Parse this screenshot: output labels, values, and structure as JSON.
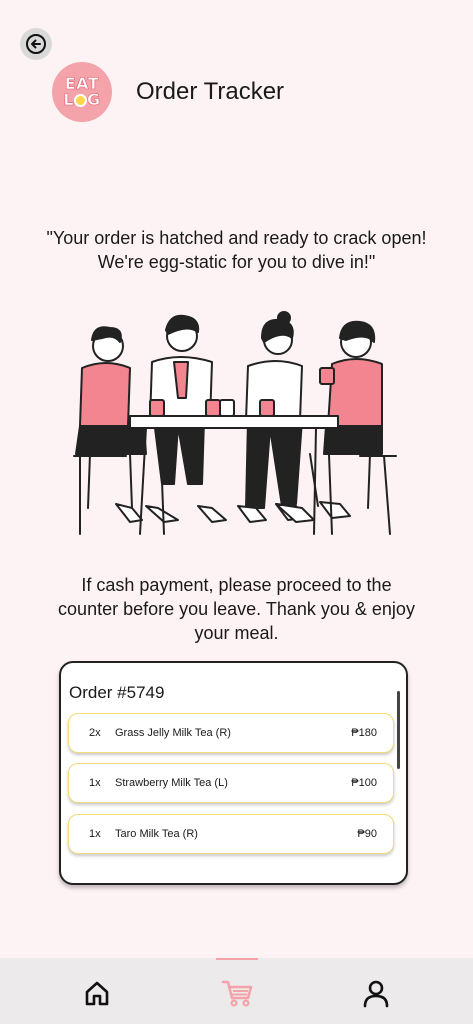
{
  "header": {
    "title": "Order Tracker",
    "logo_line1": "EAT",
    "logo_line2": "L G"
  },
  "messages": {
    "quote": "\"Your order is hatched and ready to crack open! We're egg-static for you to dive in!\"",
    "notice": "If cash payment, please proceed to the counter before you leave. Thank you & enjoy your meal."
  },
  "order": {
    "title": "Order #5749",
    "items": [
      {
        "qty": "2x",
        "name": "Grass Jelly Milk Tea (R)",
        "price": "₱180"
      },
      {
        "qty": "1x",
        "name": "Strawberry Milk Tea (L)",
        "price": "₱100"
      },
      {
        "qty": "1x",
        "name": "Taro Milk Tea (R)",
        "price": "₱90"
      }
    ]
  },
  "nav": {
    "active": "cart",
    "items": [
      "home-icon",
      "cart-icon",
      "profile-icon"
    ]
  },
  "colors": {
    "background": "#fdf3f4",
    "accent": "#f4a3aa",
    "item_border": "#f0dc7a",
    "nav_bg": "#eceaea"
  }
}
